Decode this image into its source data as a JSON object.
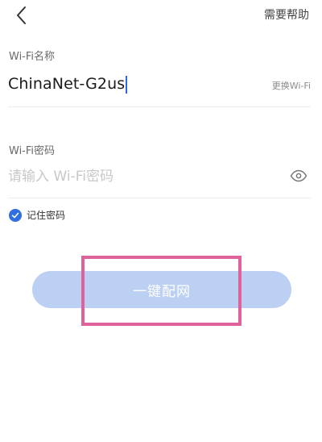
{
  "header": {
    "help_label": "需要帮助"
  },
  "ssid": {
    "label": "Wi-Fi名称",
    "value": "ChinaNet-G2us",
    "change_label": "更换Wi-Fi"
  },
  "password": {
    "label": "Wi-Fi密码",
    "placeholder": "请输入 Wi-Fi密码",
    "value": ""
  },
  "remember": {
    "label": "记住密码",
    "checked": true
  },
  "connect_button": {
    "label": "一键配网"
  },
  "colors": {
    "accent": "#2f6fe0",
    "button_disabled": "#bcd0f4",
    "highlight": "#e0629a"
  },
  "icons": {
    "back": "chevron-left-icon",
    "eye": "eye-icon",
    "check": "check-icon"
  }
}
